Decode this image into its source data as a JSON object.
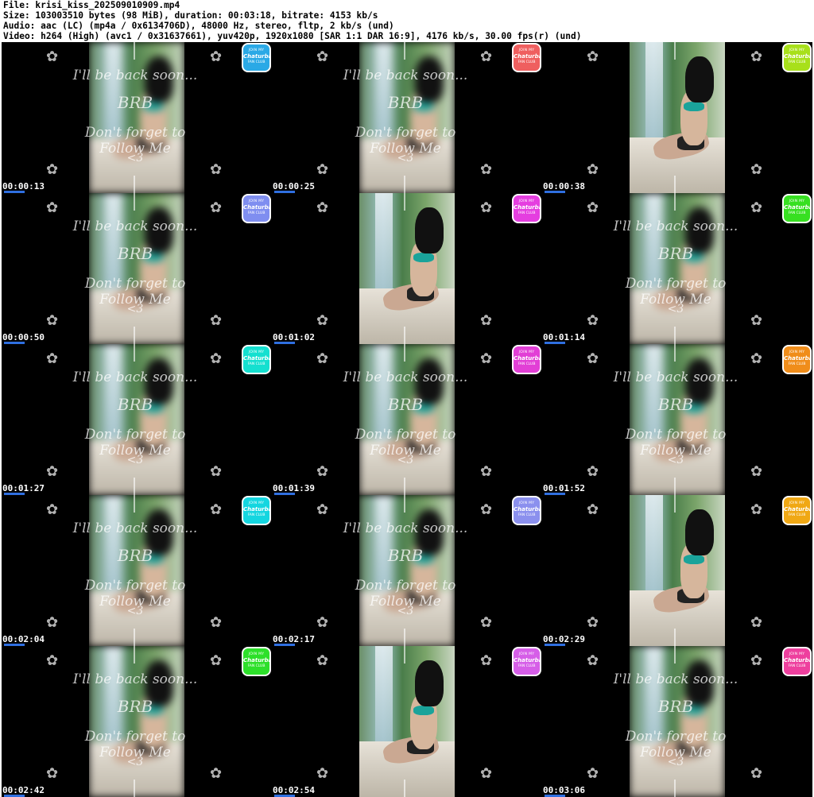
{
  "header": {
    "file_line": "File: krisi_kiss_202509010909.mp4",
    "size_line": "Size: 103003510 bytes (98 MiB), duration: 00:03:18, bitrate: 4153 kb/s",
    "audio_line": "Audio: aac (LC) (mp4a / 0x6134706D), 48000 Hz, stereo, fltp, 2 kb/s (und)",
    "video_line": "Video: h264 (High) (avc1 / 0x31637661), yuv420p, 1920x1080 [SAR 1:1 DAR 16:9], 4176 kb/s, 30.00 fps(r) (und)"
  },
  "overlay_text": {
    "back_soon": "I'll be back soon...",
    "brb": "BRB",
    "follow": "Don't forget to Follow Me",
    "heart": "<3"
  },
  "badge_text": {
    "line1": "JOIN MY",
    "line2": "Chaturbate",
    "line3": "FAN CLUB"
  },
  "thumbnails": [
    {
      "timestamp": "00:00:13",
      "badge_color": "#2aa9e6",
      "sharp": false
    },
    {
      "timestamp": "00:00:25",
      "badge_color": "#ef5f5f",
      "sharp": false
    },
    {
      "timestamp": "00:00:38",
      "badge_color": "#a8e01a",
      "sharp": true
    },
    {
      "timestamp": "00:00:50",
      "badge_color": "#7f8ef0",
      "sharp": false
    },
    {
      "timestamp": "00:01:02",
      "badge_color": "#e53ee0",
      "sharp": true
    },
    {
      "timestamp": "00:01:14",
      "badge_color": "#37e021",
      "sharp": false
    },
    {
      "timestamp": "00:01:27",
      "badge_color": "#14e0d0",
      "sharp": false
    },
    {
      "timestamp": "00:01:39",
      "badge_color": "#e23fd6",
      "sharp": false
    },
    {
      "timestamp": "00:01:52",
      "badge_color": "#f08d1a",
      "sharp": false
    },
    {
      "timestamp": "00:02:04",
      "badge_color": "#14d6e0",
      "sharp": false
    },
    {
      "timestamp": "00:02:17",
      "badge_color": "#8b90ee",
      "sharp": false
    },
    {
      "timestamp": "00:02:29",
      "badge_color": "#f0a814",
      "sharp": true
    },
    {
      "timestamp": "00:02:42",
      "badge_color": "#2de02a",
      "sharp": false
    },
    {
      "timestamp": "00:02:54",
      "badge_color": "#d65ee8",
      "sharp": true
    },
    {
      "timestamp": "00:03:06",
      "badge_color": "#ee3f9e",
      "sharp": false
    }
  ]
}
